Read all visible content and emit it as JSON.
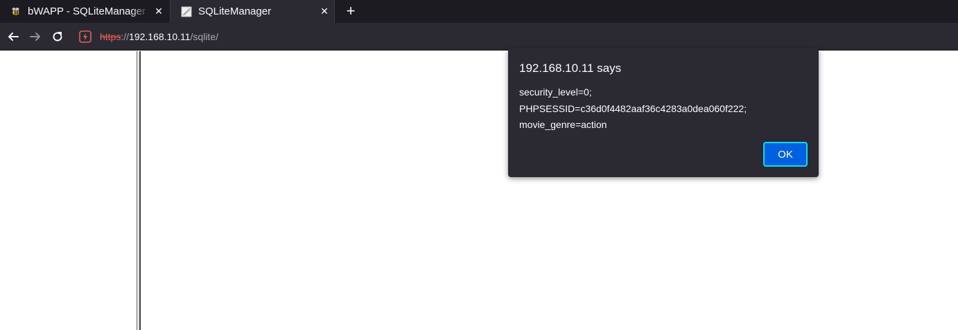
{
  "tabs": [
    {
      "title": "bWAPP - SQLiteManager",
      "active": false,
      "icon": "bee-icon"
    },
    {
      "title": "SQLiteManager",
      "active": true,
      "icon": "page-icon"
    }
  ],
  "new_tab_label": "+",
  "close_glyph": "✕",
  "address": {
    "scheme": "https",
    "separator": "://",
    "host": "192.168.10.11",
    "path": "/sqlite/"
  },
  "dialog": {
    "title": "192.168.10.11 says",
    "message_lines": [
      "security_level=0;",
      "PHPSESSID=c36d0f4482aaf36c4283a0dea060f222;",
      "movie_genre=action"
    ],
    "ok_label": "OK"
  },
  "colors": {
    "accent": "#0061e0",
    "focus_ring": "#00ddff",
    "insecure_warning": "#e36152",
    "chrome_bg": "#2b2a33",
    "tabstrip_bg": "#1c1b22"
  }
}
